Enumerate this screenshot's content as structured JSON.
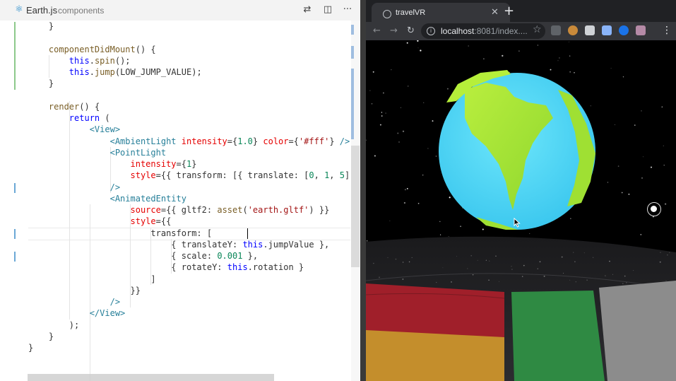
{
  "editor": {
    "tab": {
      "filename": "Earth.js",
      "directory": "components"
    },
    "actions": [
      {
        "name": "open-changes-icon",
        "glyph": "⇄"
      },
      {
        "name": "split-editor-icon",
        "glyph": "◫"
      },
      {
        "name": "more-actions-icon",
        "glyph": "···"
      }
    ],
    "code_lines": [
      [
        [
          "pl",
          "    }"
        ]
      ],
      [
        [
          "pl",
          ""
        ]
      ],
      [
        [
          "pl",
          "    "
        ],
        [
          "fn",
          "componentDidMount"
        ],
        [
          "pl",
          "() {"
        ]
      ],
      [
        [
          "pl",
          "        "
        ],
        [
          "k",
          "this"
        ],
        [
          "pl",
          "."
        ],
        [
          "fn",
          "spin"
        ],
        [
          "pl",
          "();"
        ]
      ],
      [
        [
          "pl",
          "        "
        ],
        [
          "k",
          "this"
        ],
        [
          "pl",
          "."
        ],
        [
          "fn",
          "jump"
        ],
        [
          "pl",
          "(LOW_JUMP_VALUE);"
        ]
      ],
      [
        [
          "pl",
          "    }"
        ]
      ],
      [
        [
          "pl",
          ""
        ]
      ],
      [
        [
          "pl",
          "    "
        ],
        [
          "fn",
          "render"
        ],
        [
          "pl",
          "() {"
        ]
      ],
      [
        [
          "pl",
          "        "
        ],
        [
          "k",
          "return"
        ],
        [
          "pl",
          " ("
        ]
      ],
      [
        [
          "pl",
          "            "
        ],
        [
          "tag",
          "<View>"
        ]
      ],
      [
        [
          "pl",
          "                "
        ],
        [
          "tag",
          "<AmbientLight"
        ],
        [
          "pl",
          " "
        ],
        [
          "at",
          "intensity"
        ],
        [
          "pl",
          "={"
        ],
        [
          "nm",
          "1.0"
        ],
        [
          "pl",
          "} "
        ],
        [
          "at",
          "color"
        ],
        [
          "pl",
          "={"
        ],
        [
          "st",
          "'#fff'"
        ],
        [
          "pl",
          "} "
        ],
        [
          "tag",
          "/>"
        ]
      ],
      [
        [
          "pl",
          "                "
        ],
        [
          "tag",
          "<PointLight"
        ]
      ],
      [
        [
          "pl",
          "                    "
        ],
        [
          "at",
          "intensity"
        ],
        [
          "pl",
          "={"
        ],
        [
          "nm",
          "1"
        ],
        [
          "pl",
          "}"
        ]
      ],
      [
        [
          "pl",
          "                    "
        ],
        [
          "at",
          "style"
        ],
        [
          "pl",
          "={{ transform: [{ translate: ["
        ],
        [
          "nm",
          "0"
        ],
        [
          "pl",
          ", "
        ],
        [
          "nm",
          "1"
        ],
        [
          "pl",
          ", "
        ],
        [
          "nm",
          "5"
        ],
        [
          "pl",
          "] }] }}"
        ]
      ],
      [
        [
          "pl",
          "                "
        ],
        [
          "tag",
          "/>"
        ]
      ],
      [
        [
          "pl",
          "                "
        ],
        [
          "tag",
          "<AnimatedEntity"
        ]
      ],
      [
        [
          "pl",
          "                    "
        ],
        [
          "at",
          "source"
        ],
        [
          "pl",
          "={{ gltf2: "
        ],
        [
          "fn",
          "asset"
        ],
        [
          "pl",
          "("
        ],
        [
          "st",
          "'earth.gltf'"
        ],
        [
          "pl",
          ") }}"
        ]
      ],
      [
        [
          "pl",
          "                    "
        ],
        [
          "at",
          "style"
        ],
        [
          "pl",
          "={{"
        ]
      ],
      [
        [
          "pl",
          "                        transform: ["
        ]
      ],
      [
        [
          "pl",
          "                            { translateY: "
        ],
        [
          "k",
          "this"
        ],
        [
          "pl",
          ".jumpValue },"
        ]
      ],
      [
        [
          "pl",
          "                            { scale: "
        ],
        [
          "nm",
          "0.001"
        ],
        [
          "pl",
          " },"
        ]
      ],
      [
        [
          "pl",
          "                            { rotateY: "
        ],
        [
          "k",
          "this"
        ],
        [
          "pl",
          ".rotation }"
        ]
      ],
      [
        [
          "pl",
          "                        ]"
        ]
      ],
      [
        [
          "pl",
          "                    }}"
        ]
      ],
      [
        [
          "pl",
          "                "
        ],
        [
          "tag",
          "/>"
        ]
      ],
      [
        [
          "pl",
          "            "
        ],
        [
          "tag",
          "</View>"
        ]
      ],
      [
        [
          "pl",
          "        );"
        ]
      ],
      [
        [
          "pl",
          "    }"
        ]
      ],
      [
        [
          "pl",
          "}"
        ]
      ]
    ],
    "git_gutter": [
      {
        "line": 1,
        "span": 6,
        "color": "#8dc98b"
      },
      {
        "line": 15,
        "span": 1,
        "color": "#6ba8d6"
      },
      {
        "line": 19,
        "span": 1,
        "color": "#6ba8d6"
      },
      {
        "line": 21,
        "span": 1,
        "color": "#6ba8d6"
      }
    ],
    "cursor": {
      "line": 19,
      "column": 43
    }
  },
  "browser": {
    "tab_title": "travelVR",
    "tab_close_glyph": "✕",
    "new_tab_glyph": "+",
    "nav": {
      "back": "←",
      "forward": "→",
      "reload": "↻"
    },
    "url_host": "localhost",
    "url_rest": ":8081/index....",
    "star_glyph": "☆",
    "info_glyph": "i",
    "menu_glyph": "⋮",
    "extensions": [
      {
        "name": "extension-sync-icon",
        "color": "#5f6368"
      },
      {
        "name": "extension-cookie-icon",
        "color": "#c98a3a"
      },
      {
        "name": "extension-react-icon",
        "color": "#cfd2d6"
      },
      {
        "name": "extension-pen-icon",
        "color": "#8ab4f8"
      },
      {
        "name": "extension-circle-icon",
        "color": "#1a73e8"
      },
      {
        "name": "extension-puzzle-icon",
        "color": "#b58aa6"
      }
    ],
    "scene": {
      "description_icon": "vr-enter-icon",
      "colors": {
        "ocean": "#4fd4f3",
        "land": "#a8e43a",
        "panel_red": "#a01f2a",
        "panel_green": "#2f8a43",
        "panel_gray": "#8c8c8c"
      }
    }
  }
}
